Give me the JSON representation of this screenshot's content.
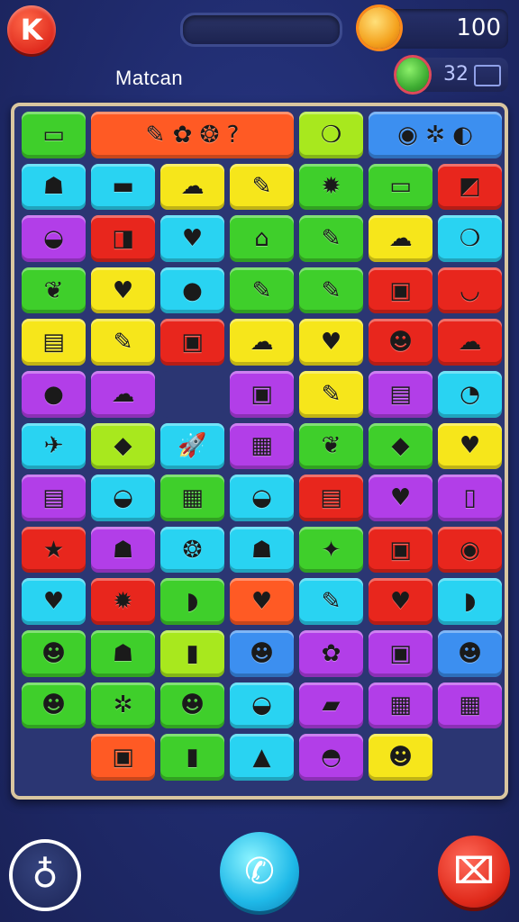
{
  "header": {
    "logo_letter": "K",
    "coins": "100",
    "title": "Matcan",
    "sub_count": "32"
  },
  "colors": {
    "green": "#3fcf2b",
    "cyan": "#29d3f2",
    "yellow": "#f6e61b",
    "orange": "#ff5a24",
    "red": "#e8261d",
    "purple": "#b23ee8",
    "lime": "#a8e81e",
    "navy": "#233a9c",
    "blue": "#3c8ff0"
  },
  "board": {
    "rows": [
      [
        {
          "c": "green",
          "g": "▭"
        },
        {
          "c": "orange",
          "g": "✎  ✿ ❂   ?",
          "span": 3
        },
        {
          "c": "lime",
          "g": "❍"
        },
        {
          "c": "blue",
          "g": "◉  ✲  ◐",
          "span": 2
        }
      ],
      [
        {
          "c": "cyan",
          "g": "☗"
        },
        {
          "c": "cyan",
          "g": "▬"
        },
        {
          "c": "yellow",
          "g": "☁"
        },
        {
          "c": "yellow",
          "g": "✎"
        },
        {
          "c": "green",
          "g": "✹"
        },
        {
          "c": "green",
          "g": "▭"
        },
        {
          "c": "red",
          "g": "◩"
        }
      ],
      [
        {
          "c": "purple",
          "g": "◒"
        },
        {
          "c": "red",
          "g": "◨"
        },
        {
          "c": "cyan",
          "g": "♥"
        },
        {
          "c": "green",
          "g": "⌂"
        },
        {
          "c": "green",
          "g": "✎"
        },
        {
          "c": "yellow",
          "g": "☁"
        },
        {
          "c": "cyan",
          "g": "❍"
        }
      ],
      [
        {
          "c": "green",
          "g": "❦"
        },
        {
          "c": "yellow",
          "g": "♥"
        },
        {
          "c": "cyan",
          "g": "●"
        },
        {
          "c": "green",
          "g": "✎"
        },
        {
          "c": "green",
          "g": "✎"
        },
        {
          "c": "red",
          "g": "▣"
        },
        {
          "c": "red",
          "g": "◡"
        }
      ],
      [
        {
          "c": "yellow",
          "g": "▤"
        },
        {
          "c": "yellow",
          "g": "✎"
        },
        {
          "c": "red",
          "g": "▣"
        },
        {
          "c": "yellow",
          "g": "☁"
        },
        {
          "c": "yellow",
          "g": "♥"
        },
        {
          "c": "red",
          "g": "☻"
        },
        {
          "c": "red",
          "g": "☁"
        }
      ],
      [
        {
          "c": "purple",
          "g": "●"
        },
        {
          "c": "purple",
          "g": "☁"
        },
        {
          "c": "empty",
          "g": ""
        },
        {
          "c": "purple",
          "g": "▣"
        },
        {
          "c": "yellow",
          "g": "✎"
        },
        {
          "c": "purple",
          "g": "▤"
        },
        {
          "c": "cyan",
          "g": "◔"
        }
      ],
      [
        {
          "c": "cyan",
          "g": "✈"
        },
        {
          "c": "lime",
          "g": "◆"
        },
        {
          "c": "cyan",
          "g": "🚀"
        },
        {
          "c": "purple",
          "g": "▦"
        },
        {
          "c": "green",
          "g": "❦"
        },
        {
          "c": "green",
          "g": "◆"
        },
        {
          "c": "yellow",
          "g": "♥"
        }
      ],
      [
        {
          "c": "purple",
          "g": "▤"
        },
        {
          "c": "cyan",
          "g": "◒"
        },
        {
          "c": "green",
          "g": "▦"
        },
        {
          "c": "cyan",
          "g": "◒"
        },
        {
          "c": "red",
          "g": "▤"
        },
        {
          "c": "purple",
          "g": "♥"
        },
        {
          "c": "purple",
          "g": "▯"
        }
      ],
      [
        {
          "c": "red",
          "g": "★"
        },
        {
          "c": "purple",
          "g": "☗"
        },
        {
          "c": "cyan",
          "g": "❂"
        },
        {
          "c": "cyan",
          "g": "☗"
        },
        {
          "c": "green",
          "g": "✦"
        },
        {
          "c": "red",
          "g": "▣"
        },
        {
          "c": "red",
          "g": "◉"
        }
      ],
      [
        {
          "c": "cyan",
          "g": "♥"
        },
        {
          "c": "red",
          "g": "✹"
        },
        {
          "c": "green",
          "g": "◗"
        },
        {
          "c": "orange",
          "g": "♥"
        },
        {
          "c": "cyan",
          "g": "✎"
        },
        {
          "c": "red",
          "g": "♥"
        },
        {
          "c": "cyan",
          "g": "◗"
        }
      ],
      [
        {
          "c": "green",
          "g": "☻"
        },
        {
          "c": "green",
          "g": "☗"
        },
        {
          "c": "lime",
          "g": "▮"
        },
        {
          "c": "blue",
          "g": "☻"
        },
        {
          "c": "purple",
          "g": "✿"
        },
        {
          "c": "purple",
          "g": "▣"
        },
        {
          "c": "blue",
          "g": "☻"
        }
      ],
      [
        {
          "c": "green",
          "g": "☻"
        },
        {
          "c": "green",
          "g": "✲"
        },
        {
          "c": "green",
          "g": "☻"
        },
        {
          "c": "cyan",
          "g": "◒"
        },
        {
          "c": "purple",
          "g": "▰"
        },
        {
          "c": "purple",
          "g": "▦"
        },
        {
          "c": "purple",
          "g": "▦"
        }
      ],
      [
        {
          "c": "none",
          "g": ""
        },
        {
          "c": "orange",
          "g": "▣"
        },
        {
          "c": "green",
          "g": "▮"
        },
        {
          "c": "cyan",
          "g": "▲"
        },
        {
          "c": "purple",
          "g": "◓"
        },
        {
          "c": "yellow",
          "g": "☻"
        },
        {
          "c": "none",
          "g": ""
        }
      ]
    ]
  },
  "bottom": {
    "left_icon": "♁",
    "mid_icon": "✆",
    "right_icon": "⌧"
  }
}
